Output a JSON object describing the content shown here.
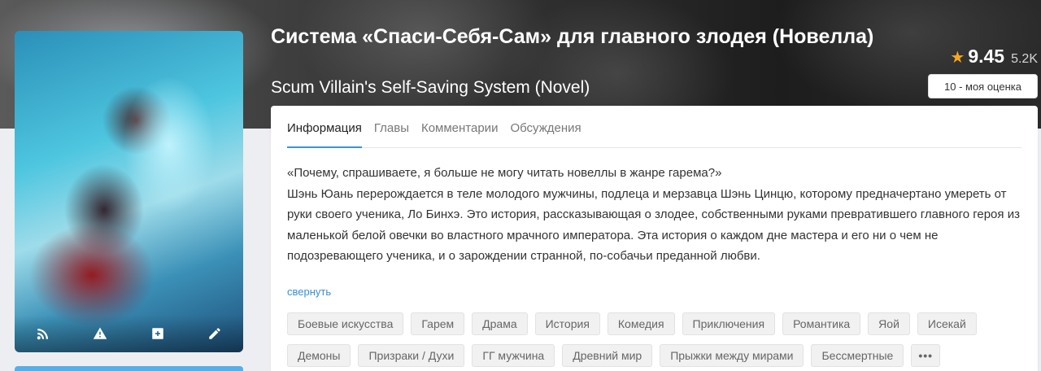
{
  "header": {
    "title_ru": "Система «Спаси-Себя-Сам» для главного злодея (Новелла)",
    "title_en": "Scum Villain's Self-Saving System (Novel)"
  },
  "rating": {
    "score": "9.45",
    "votes": "5.2K",
    "my_rating": "10 - моя оценка",
    "star_color": "#f5a623"
  },
  "cover": {
    "actions": [
      {
        "icon": "rss-icon"
      },
      {
        "icon": "warning-icon"
      },
      {
        "icon": "plus-square-icon"
      },
      {
        "icon": "pencil-icon"
      }
    ]
  },
  "tabs": [
    {
      "label": "Информация",
      "active": true
    },
    {
      "label": "Главы",
      "active": false
    },
    {
      "label": "Комментарии",
      "active": false
    },
    {
      "label": "Обсуждения",
      "active": false
    }
  ],
  "description": {
    "line1": "«Почему, спрашиваете, я больше не могу читать новеллы в жанре гарема?»",
    "body": "Шэнь Юань перерождается в теле молодого мужчины, подлеца и мерзавца Шэнь Цинцю, которому предначертано умереть от руки своего ученика, Ло Бинхэ. Это история, рассказывающая о злодее, собственными руками превратившего главного героя из маленькой белой овечки во властного мрачного императора. Эта история о каждом дне мастера и его ни о чем не подозревающего ученика, и о зарождении странной, по-собачьи преданной любви.",
    "collapse_label": "свернуть"
  },
  "tags": [
    "Боевые искусства",
    "Гарем",
    "Драма",
    "История",
    "Комедия",
    "Приключения",
    "Романтика",
    "Яой",
    "Исекай",
    "Демоны",
    "Призраки / Духи",
    "ГГ мужчина",
    "Древний мир",
    "Прыжки между мирами",
    "Бессмертные"
  ],
  "tags_more_label": "•••",
  "colors": {
    "accent": "#3a93d5",
    "link": "#3a8fd1"
  }
}
